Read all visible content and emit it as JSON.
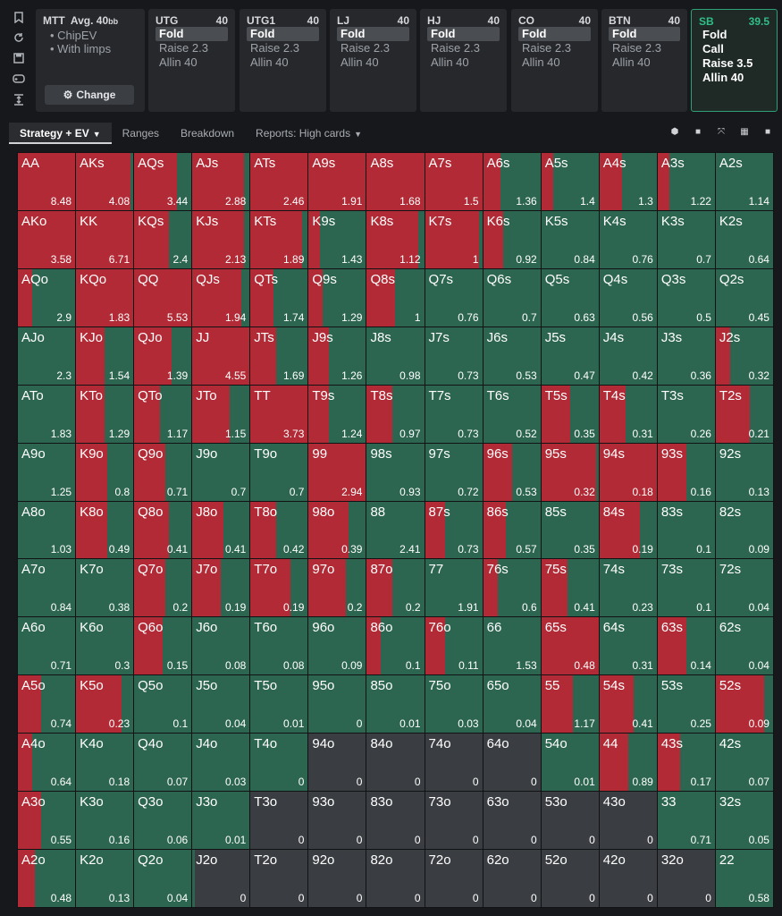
{
  "left_toolbar": {
    "icons": [
      "bookmark-icon",
      "refresh-icon",
      "save-icon",
      "gamepad-icon",
      "vertical-expand-icon"
    ]
  },
  "info": {
    "game": "MTT",
    "stack_label": "Avg. 40",
    "stack_unit": "bb",
    "items": [
      "• ChipEV",
      "• With limps"
    ],
    "change_label": "Change"
  },
  "positions": [
    {
      "name": "UTG",
      "stack": "40",
      "options": [
        "Fold",
        "Raise 2.3",
        "Allin 40"
      ],
      "selected": 0
    },
    {
      "name": "UTG1",
      "stack": "40",
      "options": [
        "Fold",
        "Raise 2.3",
        "Allin 40"
      ],
      "selected": 0
    },
    {
      "name": "LJ",
      "stack": "40",
      "options": [
        "Fold",
        "Raise 2.3",
        "Allin 40"
      ],
      "selected": 0
    },
    {
      "name": "HJ",
      "stack": "40",
      "options": [
        "Fold",
        "Raise 2.3",
        "Allin 40"
      ],
      "selected": 0
    },
    {
      "name": "CO",
      "stack": "40",
      "options": [
        "Fold",
        "Raise 2.3",
        "Allin 40"
      ],
      "selected": 0
    },
    {
      "name": "BTN",
      "stack": "40",
      "options": [
        "Fold",
        "Raise 2.3",
        "Allin 40"
      ],
      "selected": 0
    },
    {
      "name": "SB",
      "stack": "39.5",
      "options": [
        "Fold",
        "Call",
        "Raise 3.5",
        "Allin 40"
      ],
      "selected": -1
    }
  ],
  "tabs": [
    {
      "label": "Strategy + EV",
      "active": true,
      "dropdown": true
    },
    {
      "label": "Ranges",
      "active": false,
      "dropdown": false
    },
    {
      "label": "Breakdown",
      "active": false,
      "dropdown": false
    },
    {
      "label": "Reports: High cards",
      "active": false,
      "dropdown": true
    }
  ],
  "view_tools": [
    "cube-icon",
    "square-icon",
    "expand-icon",
    "grid-icon",
    "square-small-icon"
  ],
  "colors": {
    "raise": "#b22a35",
    "call": "#2d6650",
    "fold": "#3a3d41",
    "sb_accent": "#2fbf88"
  },
  "matrix": {
    "rows": [
      [
        "AA",
        "AKs",
        "AQs",
        "AJs",
        "ATs",
        "A9s",
        "A8s",
        "A7s",
        "A6s",
        "A5s",
        "A4s",
        "A3s",
        "A2s"
      ],
      [
        "AKo",
        "KK",
        "KQs",
        "KJs",
        "KTs",
        "K9s",
        "K8s",
        "K7s",
        "K6s",
        "K5s",
        "K4s",
        "K3s",
        "K2s"
      ],
      [
        "AQo",
        "KQo",
        "QQ",
        "QJs",
        "QTs",
        "Q9s",
        "Q8s",
        "Q7s",
        "Q6s",
        "Q5s",
        "Q4s",
        "Q3s",
        "Q2s"
      ],
      [
        "AJo",
        "KJo",
        "QJo",
        "JJ",
        "JTs",
        "J9s",
        "J8s",
        "J7s",
        "J6s",
        "J5s",
        "J4s",
        "J3s",
        "J2s"
      ],
      [
        "ATo",
        "KTo",
        "QTo",
        "JTo",
        "TT",
        "T9s",
        "T8s",
        "T7s",
        "T6s",
        "T5s",
        "T4s",
        "T3s",
        "T2s"
      ],
      [
        "A9o",
        "K9o",
        "Q9o",
        "J9o",
        "T9o",
        "99",
        "98s",
        "97s",
        "96s",
        "95s",
        "94s",
        "93s",
        "92s"
      ],
      [
        "A8o",
        "K8o",
        "Q8o",
        "J8o",
        "T8o",
        "98o",
        "88",
        "87s",
        "86s",
        "85s",
        "84s",
        "83s",
        "82s"
      ],
      [
        "A7o",
        "K7o",
        "Q7o",
        "J7o",
        "T7o",
        "97o",
        "87o",
        "77",
        "76s",
        "75s",
        "74s",
        "73s",
        "72s"
      ],
      [
        "A6o",
        "K6o",
        "Q6o",
        "J6o",
        "T6o",
        "96o",
        "86o",
        "76o",
        "66",
        "65s",
        "64s",
        "63s",
        "62s"
      ],
      [
        "A5o",
        "K5o",
        "Q5o",
        "J5o",
        "T5o",
        "95o",
        "85o",
        "75o",
        "65o",
        "55",
        "54s",
        "53s",
        "52s"
      ],
      [
        "A4o",
        "K4o",
        "Q4o",
        "J4o",
        "T4o",
        "94o",
        "84o",
        "74o",
        "64o",
        "54o",
        "44",
        "43s",
        "42s"
      ],
      [
        "A3o",
        "K3o",
        "Q3o",
        "J3o",
        "T3o",
        "93o",
        "83o",
        "73o",
        "63o",
        "53o",
        "43o",
        "33",
        "32s"
      ],
      [
        "A2o",
        "K2o",
        "Q2o",
        "J2o",
        "T2o",
        "92o",
        "82o",
        "72o",
        "62o",
        "52o",
        "42o",
        "32o",
        "22"
      ]
    ],
    "ev": [
      [
        "8.48",
        "4.08",
        "3.44",
        "2.88",
        "2.46",
        "1.91",
        "1.68",
        "1.5",
        "1.36",
        "1.4",
        "1.3",
        "1.22",
        "1.14"
      ],
      [
        "3.58",
        "6.71",
        "2.4",
        "2.13",
        "1.89",
        "1.43",
        "1.12",
        "1",
        "0.92",
        "0.84",
        "0.76",
        "0.7",
        "0.64"
      ],
      [
        "2.9",
        "1.83",
        "5.53",
        "1.94",
        "1.74",
        "1.29",
        "1",
        "0.76",
        "0.7",
        "0.63",
        "0.56",
        "0.5",
        "0.45"
      ],
      [
        "2.3",
        "1.54",
        "1.39",
        "4.55",
        "1.69",
        "1.26",
        "0.98",
        "0.73",
        "0.53",
        "0.47",
        "0.42",
        "0.36",
        "0.32"
      ],
      [
        "1.83",
        "1.29",
        "1.17",
        "1.15",
        "3.73",
        "1.24",
        "0.97",
        "0.73",
        "0.52",
        "0.35",
        "0.31",
        "0.26",
        "0.21"
      ],
      [
        "1.25",
        "0.8",
        "0.71",
        "0.7",
        "0.7",
        "2.94",
        "0.93",
        "0.72",
        "0.53",
        "0.32",
        "0.18",
        "0.16",
        "0.13"
      ],
      [
        "1.03",
        "0.49",
        "0.41",
        "0.41",
        "0.42",
        "0.39",
        "2.41",
        "0.73",
        "0.57",
        "0.35",
        "0.19",
        "0.1",
        "0.09"
      ],
      [
        "0.84",
        "0.38",
        "0.2",
        "0.19",
        "0.19",
        "0.2",
        "0.2",
        "1.91",
        "0.6",
        "0.41",
        "0.23",
        "0.1",
        "0.04"
      ],
      [
        "0.71",
        "0.3",
        "0.15",
        "0.08",
        "0.08",
        "0.09",
        "0.1",
        "0.11",
        "1.53",
        "0.48",
        "0.31",
        "0.14",
        "0.04"
      ],
      [
        "0.74",
        "0.23",
        "0.1",
        "0.04",
        "0.01",
        "0",
        "0.01",
        "0.03",
        "0.04",
        "1.17",
        "0.41",
        "0.25",
        "0.09"
      ],
      [
        "0.64",
        "0.18",
        "0.07",
        "0.03",
        "0",
        "0",
        "0",
        "0",
        "0",
        "0.01",
        "0.89",
        "0.17",
        "0.07"
      ],
      [
        "0.55",
        "0.16",
        "0.06",
        "0.01",
        "0",
        "0",
        "0",
        "0",
        "0",
        "0",
        "0",
        "0.71",
        "0.05"
      ],
      [
        "0.48",
        "0.13",
        "0.04",
        "0",
        "0",
        "0",
        "0",
        "0",
        "0",
        "0",
        "0",
        "0",
        "0.58"
      ]
    ],
    "raise_pct": [
      [
        1.0,
        0.95,
        0.75,
        0.9,
        1.0,
        1.0,
        1.0,
        1.0,
        0.3,
        0.2,
        0.4,
        0.2,
        0.0
      ],
      [
        1.0,
        1.0,
        0.6,
        0.9,
        0.9,
        0.2,
        0.9,
        0.95,
        0.35,
        0.0,
        0.0,
        0.0,
        0.0
      ],
      [
        0.25,
        1.0,
        1.0,
        0.85,
        0.4,
        0.25,
        0.5,
        0.0,
        0.0,
        0.0,
        0.0,
        0.0,
        0.0
      ],
      [
        0.0,
        0.5,
        0.65,
        1.0,
        0.45,
        0.35,
        0.0,
        0.0,
        0.0,
        0.0,
        0.0,
        0.0,
        0.25
      ],
      [
        0.0,
        0.5,
        0.45,
        0.65,
        1.0,
        0.35,
        0.45,
        0.0,
        0.0,
        0.5,
        0.45,
        0.0,
        0.6
      ],
      [
        0.0,
        0.55,
        0.55,
        0.0,
        0.0,
        1.0,
        0.0,
        0.0,
        0.5,
        0.95,
        1.0,
        0.5,
        0.0
      ],
      [
        0.0,
        0.55,
        0.6,
        0.55,
        0.45,
        0.7,
        0.0,
        0.35,
        0.4,
        0.0,
        0.7,
        0.0,
        0.0
      ],
      [
        0.0,
        0.0,
        0.55,
        0.5,
        0.7,
        0.65,
        0.45,
        0.0,
        0.25,
        0.45,
        0.0,
        0.0,
        0.0
      ],
      [
        0.0,
        0.0,
        0.5,
        0.0,
        0.0,
        0.0,
        0.25,
        0.35,
        0.0,
        1.0,
        0.0,
        0.5,
        0.0
      ],
      [
        0.4,
        0.8,
        0.0,
        0.0,
        0.0,
        0.0,
        0.0,
        0.0,
        0.0,
        0.55,
        0.6,
        0.0,
        0.85
      ],
      [
        0.25,
        0.0,
        0.0,
        0.0,
        0.0,
        0.0,
        0.0,
        0.0,
        0.0,
        0.0,
        0.5,
        0.4,
        0.0
      ],
      [
        0.4,
        0.0,
        0.0,
        0.0,
        0.0,
        0.0,
        0.0,
        0.0,
        0.0,
        0.0,
        0.0,
        0.0,
        0.0
      ],
      [
        0.3,
        0.0,
        0.0,
        0.0,
        0.0,
        0.0,
        0.0,
        0.0,
        0.0,
        0.0,
        0.0,
        0.0,
        0.0
      ]
    ],
    "call_pct": [
      [
        0.0,
        0.05,
        0.25,
        0.1,
        0.0,
        0.0,
        0.0,
        0.0,
        0.7,
        0.8,
        0.6,
        0.8,
        1.0
      ],
      [
        0.0,
        0.0,
        0.4,
        0.1,
        0.1,
        0.8,
        0.1,
        0.05,
        0.65,
        1.0,
        1.0,
        1.0,
        1.0
      ],
      [
        0.75,
        0.0,
        0.0,
        0.15,
        0.6,
        0.75,
        0.5,
        1.0,
        1.0,
        1.0,
        1.0,
        1.0,
        1.0
      ],
      [
        1.0,
        0.5,
        0.35,
        0.0,
        0.55,
        0.65,
        1.0,
        1.0,
        1.0,
        1.0,
        1.0,
        1.0,
        0.75
      ],
      [
        1.0,
        0.5,
        0.55,
        0.35,
        0.0,
        0.65,
        0.55,
        1.0,
        1.0,
        0.5,
        0.55,
        1.0,
        0.4
      ],
      [
        1.0,
        0.45,
        0.45,
        1.0,
        1.0,
        0.0,
        1.0,
        1.0,
        0.5,
        0.05,
        0.0,
        0.5,
        1.0
      ],
      [
        1.0,
        0.45,
        0.4,
        0.45,
        0.55,
        0.3,
        1.0,
        0.65,
        0.6,
        1.0,
        0.3,
        1.0,
        1.0
      ],
      [
        1.0,
        1.0,
        0.45,
        0.5,
        0.3,
        0.35,
        0.55,
        1.0,
        0.75,
        0.55,
        1.0,
        1.0,
        1.0
      ],
      [
        1.0,
        1.0,
        0.5,
        1.0,
        1.0,
        1.0,
        0.75,
        0.65,
        1.0,
        0.0,
        1.0,
        0.5,
        1.0
      ],
      [
        0.6,
        0.2,
        1.0,
        1.0,
        1.0,
        1.0,
        1.0,
        1.0,
        1.0,
        0.45,
        0.4,
        1.0,
        0.15
      ],
      [
        0.75,
        1.0,
        1.0,
        1.0,
        1.0,
        0.0,
        0.0,
        0.0,
        0.0,
        1.0,
        0.5,
        0.6,
        1.0
      ],
      [
        0.6,
        1.0,
        1.0,
        1.0,
        0.0,
        0.0,
        0.0,
        0.0,
        0.0,
        0.0,
        0.0,
        1.0,
        1.0
      ],
      [
        0.7,
        1.0,
        1.0,
        0.05,
        0.0,
        0.0,
        0.0,
        0.0,
        0.0,
        0.0,
        0.0,
        0.0,
        1.0
      ]
    ]
  }
}
